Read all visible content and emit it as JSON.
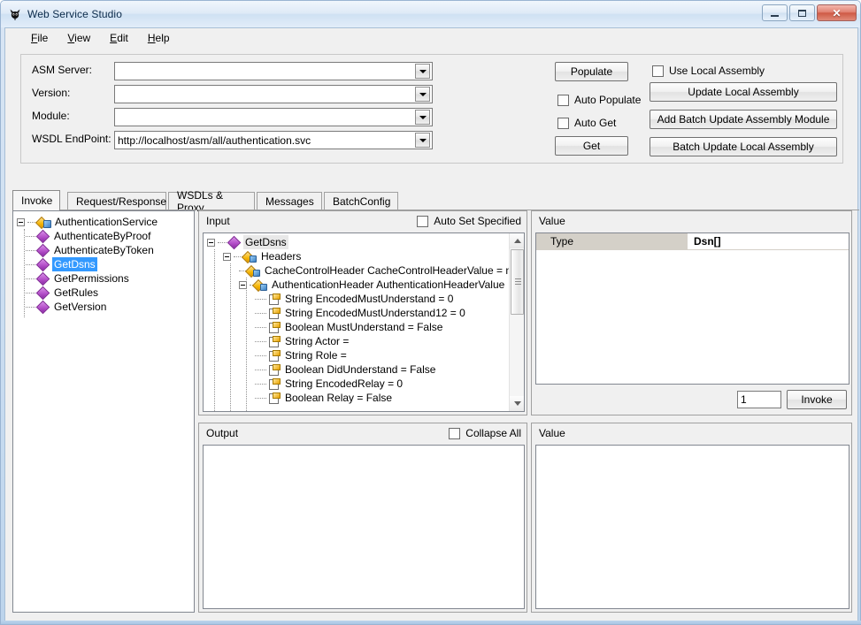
{
  "window": {
    "title": "Web Service Studio",
    "icon": "app-bug-icon",
    "controls": {
      "minimize": "–",
      "maximize": "□",
      "close": "✕"
    }
  },
  "menu": {
    "items": [
      {
        "name": "file",
        "accel": "F",
        "rest": "ile"
      },
      {
        "name": "view",
        "accel": "V",
        "rest": "iew"
      },
      {
        "name": "edit",
        "accel": "E",
        "rest": "dit"
      },
      {
        "name": "help",
        "accel": "H",
        "rest": "elp"
      }
    ]
  },
  "form": {
    "fields": [
      {
        "label": "ASM Server:",
        "value": ""
      },
      {
        "label": "Version:",
        "value": ""
      },
      {
        "label": "Module:",
        "value": ""
      },
      {
        "label": "WSDL EndPoint:",
        "value": "http://localhost/asm/all/authentication.svc"
      }
    ],
    "buttons": {
      "populate": "Populate",
      "get": "Get",
      "update_local_assembly": "Update Local Assembly",
      "add_batch_update_assembly_module": "Add Batch Update Assembly Module",
      "batch_update_local_assembly": "Batch Update Local Assembly"
    },
    "checkboxes": {
      "auto_populate": {
        "label": "Auto Populate",
        "checked": false
      },
      "auto_get": {
        "label": "Auto Get",
        "checked": false
      },
      "use_local_assembly": {
        "label": "Use Local Assembly",
        "checked": false
      }
    }
  },
  "tabs": {
    "active": "Invoke",
    "items": [
      {
        "label": "Invoke"
      },
      {
        "label": "Request/Response"
      },
      {
        "label": "WSDLs & Proxy"
      },
      {
        "label": "Messages"
      },
      {
        "label": "BatchConfig"
      }
    ]
  },
  "service_tree": {
    "root": {
      "label": "AuthenticationService",
      "icon": "service-icon",
      "expanded": true
    },
    "methods": [
      {
        "label": "AuthenticateByProof",
        "icon": "method-icon",
        "selected": false
      },
      {
        "label": "AuthenticateByToken",
        "icon": "method-icon",
        "selected": false
      },
      {
        "label": "GetDsns",
        "icon": "method-icon",
        "selected": true
      },
      {
        "label": "GetPermissions",
        "icon": "method-icon",
        "selected": false
      },
      {
        "label": "GetRules",
        "icon": "method-icon",
        "selected": false
      },
      {
        "label": "GetVersion",
        "icon": "method-icon",
        "selected": false
      }
    ]
  },
  "input_panel": {
    "title": "Input",
    "auto_set_specified": {
      "label": "Auto Set Specified",
      "checked": false
    },
    "rows": [
      {
        "depth": 0,
        "label": "GetDsns",
        "icon": "method-icon",
        "expander": "expanded",
        "selected": true
      },
      {
        "depth": 1,
        "label": "Headers",
        "icon": "class-icon",
        "expander": "expanded",
        "selected": false
      },
      {
        "depth": 2,
        "label": "CacheControlHeader CacheControlHeaderValue = null",
        "icon": "class-icon",
        "expander": "none",
        "selected": false
      },
      {
        "depth": 2,
        "label": "AuthenticationHeader AuthenticationHeaderValue",
        "icon": "class-icon",
        "expander": "expanded",
        "selected": false
      },
      {
        "depth": 3,
        "label": "String EncodedMustUnderstand = 0",
        "icon": "field-icon",
        "expander": "none",
        "selected": false
      },
      {
        "depth": 3,
        "label": "String EncodedMustUnderstand12 = 0",
        "icon": "field-icon",
        "expander": "none",
        "selected": false
      },
      {
        "depth": 3,
        "label": "Boolean MustUnderstand = False",
        "icon": "field-icon",
        "expander": "none",
        "selected": false
      },
      {
        "depth": 3,
        "label": "String Actor =",
        "icon": "field-icon",
        "expander": "none",
        "selected": false
      },
      {
        "depth": 3,
        "label": "String Role =",
        "icon": "field-icon",
        "expander": "none",
        "selected": false
      },
      {
        "depth": 3,
        "label": "Boolean DidUnderstand = False",
        "icon": "field-icon",
        "expander": "none",
        "selected": false
      },
      {
        "depth": 3,
        "label": "String EncodedRelay = 0",
        "icon": "field-icon",
        "expander": "none",
        "selected": false
      },
      {
        "depth": 3,
        "label": "Boolean Relay = False",
        "icon": "field-icon",
        "expander": "none",
        "selected": false
      }
    ]
  },
  "value_panel_top": {
    "title": "Value",
    "grid": {
      "label": "Type",
      "value": "Dsn[]"
    },
    "count_field": "1",
    "invoke_button": "Invoke"
  },
  "output_panel": {
    "title": "Output",
    "collapse_all": {
      "label": "Collapse All",
      "checked": false
    },
    "content": ""
  },
  "value_panel_bottom": {
    "title": "Value",
    "content": ""
  }
}
